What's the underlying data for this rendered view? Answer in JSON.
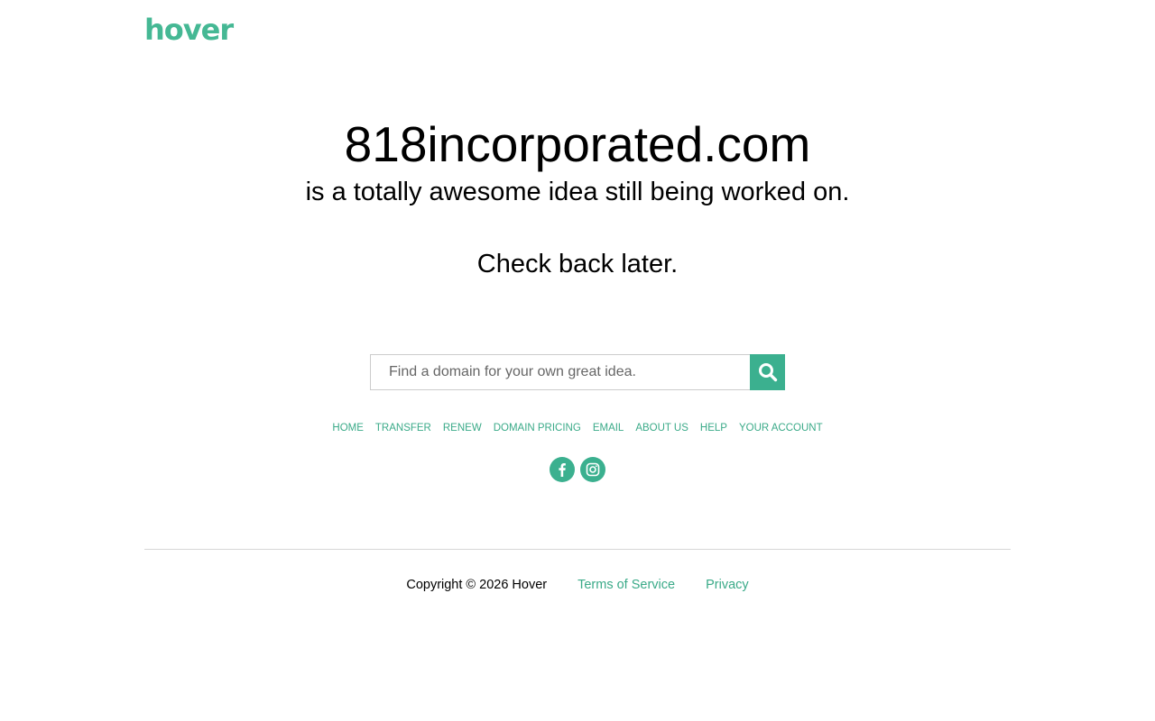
{
  "brand": {
    "logo_text": "hover",
    "logo_color": "#45b894",
    "accent_color": "#3bb08f",
    "link_color": "#3aaa88"
  },
  "hero": {
    "domain": "818incorporated.com",
    "subtitle": "is a totally awesome idea still being worked on.",
    "check_back": "Check back later."
  },
  "search": {
    "placeholder": "Find a domain for your own great idea.",
    "value": "",
    "button_icon": "search-icon"
  },
  "nav": {
    "items": [
      {
        "label": "HOME"
      },
      {
        "label": "TRANSFER"
      },
      {
        "label": "RENEW"
      },
      {
        "label": "DOMAIN PRICING"
      },
      {
        "label": "EMAIL"
      },
      {
        "label": "ABOUT US"
      },
      {
        "label": "HELP"
      },
      {
        "label": "YOUR ACCOUNT"
      }
    ]
  },
  "social": {
    "icons": [
      "facebook-icon",
      "instagram-icon"
    ]
  },
  "footer": {
    "copyright": "Copyright © 2026 Hover",
    "terms_label": "Terms of Service",
    "privacy_label": "Privacy"
  }
}
